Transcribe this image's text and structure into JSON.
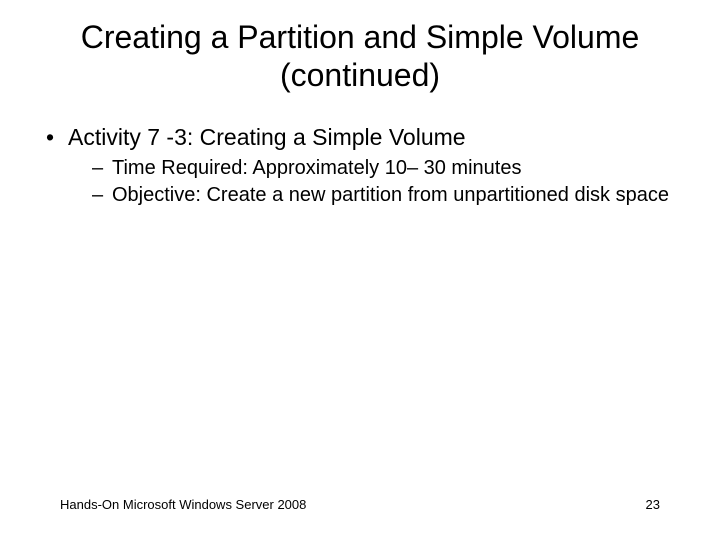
{
  "title": "Creating a Partition and Simple Volume (continued)",
  "bullets": {
    "level1": [
      {
        "text": "Activity 7 -3: Creating a Simple Volume",
        "sub": [
          "Time Required: Approximately 10– 30 minutes",
          "Objective: Create a new partition from unpartitioned disk space"
        ]
      }
    ]
  },
  "footer": {
    "left": "Hands-On Microsoft Windows Server 2008",
    "right": "23"
  }
}
